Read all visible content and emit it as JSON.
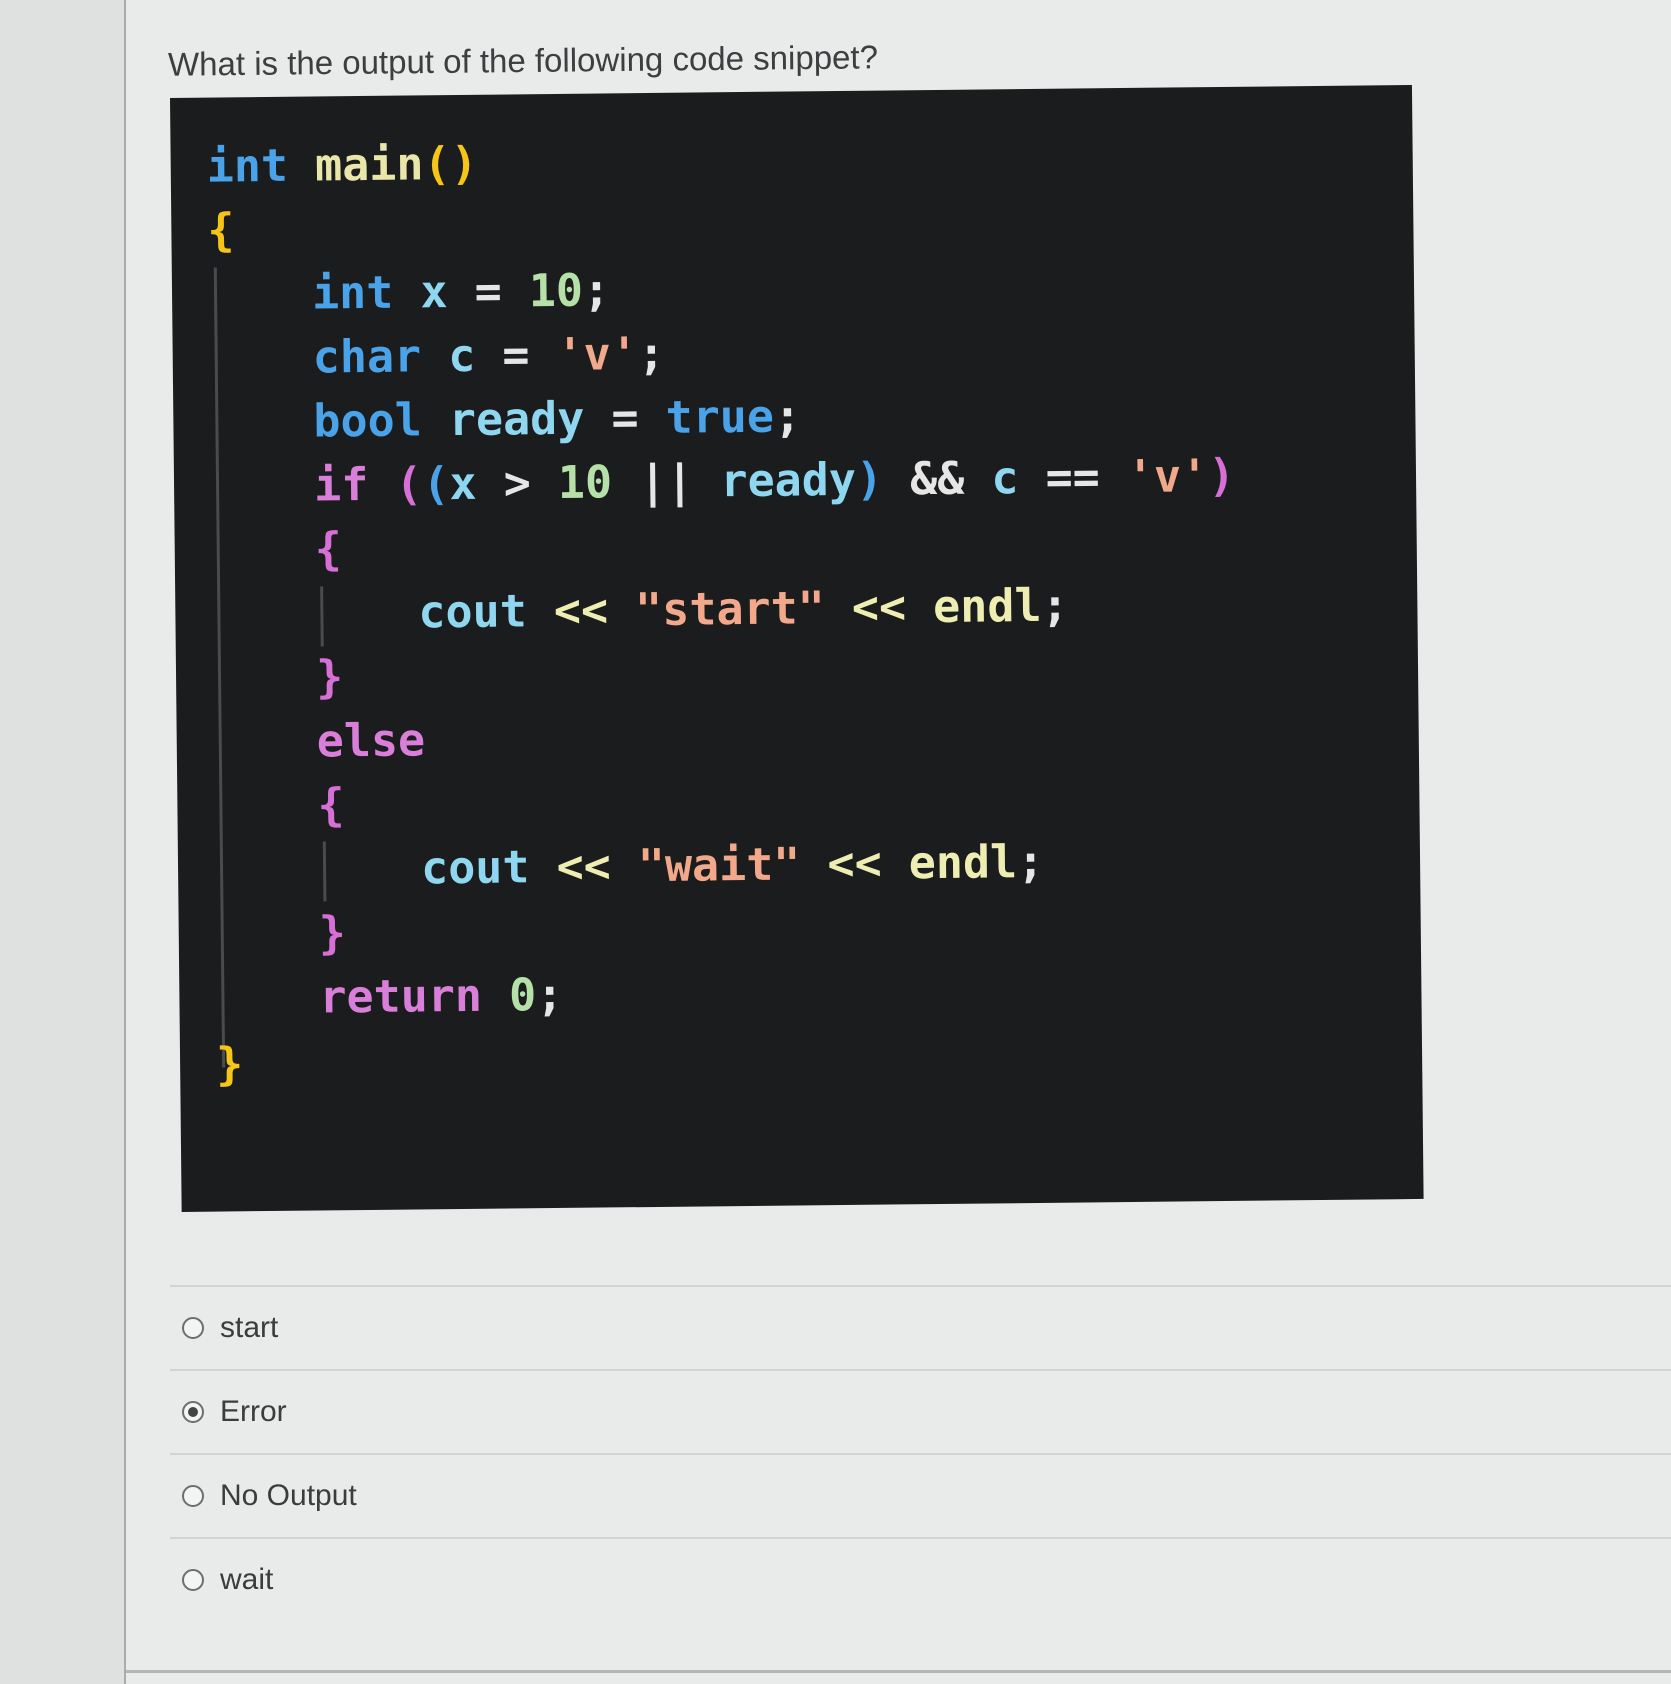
{
  "question": "What is the output of the following code snippet?",
  "code": {
    "language": "cpp",
    "lines": [
      "int main()",
      "{",
      "int x = 10;",
      "char c = 'v';",
      "bool ready = true;",
      "if ((x > 10 || ready) && c == 'v')",
      "{",
      "cout << \"start\" << endl;",
      "}",
      "else",
      "{",
      "cout << \"wait\" << endl;",
      "}",
      "return 0;",
      "}"
    ],
    "tokens": {
      "int": "int",
      "main": "main",
      "paren_open": "(",
      "paren_close": ")",
      "brace_open": "{",
      "brace_close": "}",
      "x": "x",
      "eq": "=",
      "ten": "10",
      "semi": ";",
      "char": "char",
      "c": "c",
      "char_v": "'v'",
      "bool": "bool",
      "ready": "ready",
      "true": "true",
      "if": "if",
      "gt": ">",
      "or": "||",
      "and": "&&",
      "eqeq": "==",
      "cout": "cout",
      "shl": "<<",
      "str_start": "\"start\"",
      "str_wait": "\"wait\"",
      "endl": "endl",
      "else": "else",
      "return": "return",
      "zero": "0"
    }
  },
  "options": [
    {
      "label": "start",
      "selected": false
    },
    {
      "label": "Error",
      "selected": true
    },
    {
      "label": "No Output",
      "selected": false
    },
    {
      "label": "wait",
      "selected": false
    }
  ],
  "colors": {
    "code_background": "#1b1c1d",
    "keyword": "#4aa3e8",
    "string": "#f2a88a",
    "number": "#b5e0a8",
    "control": "#d97fd9"
  }
}
